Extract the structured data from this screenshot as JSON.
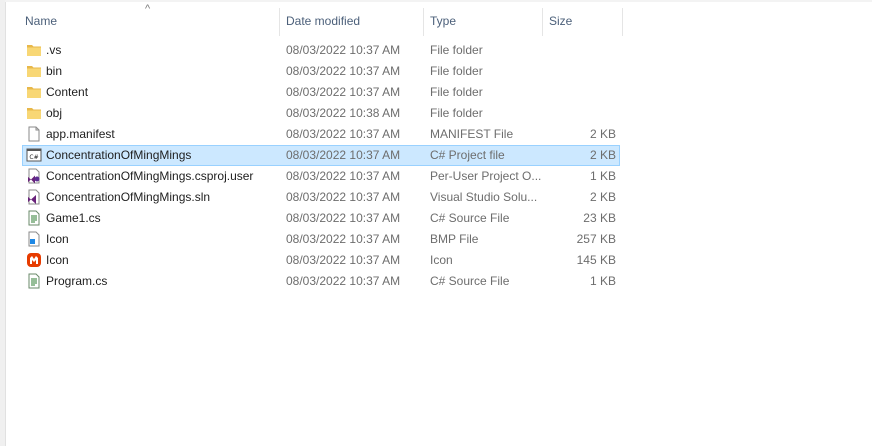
{
  "columns": {
    "name": "Name",
    "date": "Date modified",
    "type": "Type",
    "size": "Size",
    "sort_arrow": "^"
  },
  "files": [
    {
      "name": ".vs",
      "date": "08/03/2022 10:37 AM",
      "type": "File folder",
      "size": "",
      "icon": "folder-icon"
    },
    {
      "name": "bin",
      "date": "08/03/2022 10:37 AM",
      "type": "File folder",
      "size": "",
      "icon": "folder-icon"
    },
    {
      "name": "Content",
      "date": "08/03/2022 10:37 AM",
      "type": "File folder",
      "size": "",
      "icon": "folder-icon"
    },
    {
      "name": "obj",
      "date": "08/03/2022 10:38 AM",
      "type": "File folder",
      "size": "",
      "icon": "folder-icon"
    },
    {
      "name": "app.manifest",
      "date": "08/03/2022 10:37 AM",
      "type": "MANIFEST File",
      "size": "2 KB",
      "icon": "document-icon"
    },
    {
      "name": "ConcentrationOfMingMings",
      "date": "08/03/2022 10:37 AM",
      "type": "C# Project file",
      "size": "2 KB",
      "icon": "csharp-project-icon",
      "selected": true
    },
    {
      "name": "ConcentrationOfMingMings.csproj.user",
      "date": "08/03/2022 10:37 AM",
      "type": "Per-User Project O...",
      "size": "1 KB",
      "icon": "visual-studio-user-file-icon"
    },
    {
      "name": "ConcentrationOfMingMings.sln",
      "date": "08/03/2022 10:37 AM",
      "type": "Visual Studio Solu...",
      "size": "2 KB",
      "icon": "visual-studio-solution-icon"
    },
    {
      "name": "Game1.cs",
      "date": "08/03/2022 10:37 AM",
      "type": "C# Source File",
      "size": "23 KB",
      "icon": "csharp-source-icon"
    },
    {
      "name": "Icon",
      "date": "08/03/2022 10:37 AM",
      "type": "BMP File",
      "size": "257 KB",
      "icon": "bmp-image-icon"
    },
    {
      "name": "Icon",
      "date": "08/03/2022 10:37 AM",
      "type": "Icon",
      "size": "145 KB",
      "icon": "monogame-icon"
    },
    {
      "name": "Program.cs",
      "date": "08/03/2022 10:37 AM",
      "type": "C# Source File",
      "size": "1 KB",
      "icon": "csharp-source-icon"
    }
  ],
  "colors": {
    "header_text": "#4c607a",
    "selected_bg": "#cce8ff",
    "selected_border": "#99d1ff",
    "folder": "#f8d775",
    "monogame": "#e73c00"
  }
}
